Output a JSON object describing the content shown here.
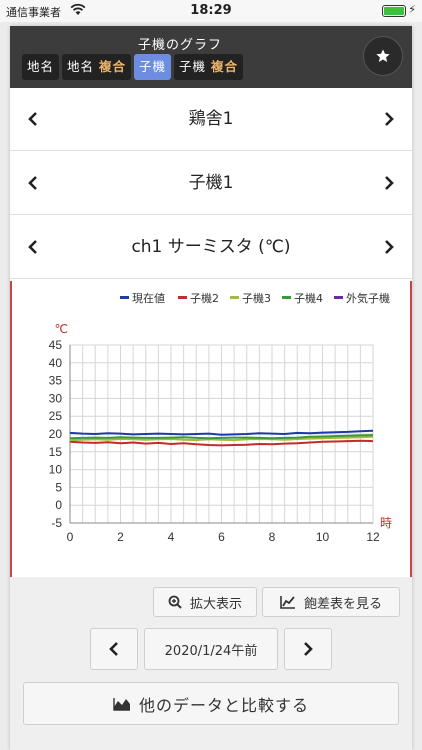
{
  "status_bar": {
    "carrier": "通信事業者",
    "time": "18:29"
  },
  "header": {
    "title": "子機のグラフ",
    "tabs": [
      {
        "text": "地名",
        "highlight": "",
        "active": false
      },
      {
        "text": "地名",
        "highlight": "複合",
        "active": false
      },
      {
        "text": "子機",
        "highlight": "",
        "active": true
      },
      {
        "text": "子機",
        "highlight": "複合",
        "active": false
      }
    ],
    "star_icon": "star-icon"
  },
  "selectors": [
    {
      "label": "鶏舎1"
    },
    {
      "label": "子機1"
    },
    {
      "label": "ch1 サーミスタ (℃)"
    }
  ],
  "chart_data": {
    "type": "line",
    "legend_position": "top-right",
    "grid": true,
    "ylabel": "℃",
    "xlabel": "時",
    "ylim": [
      -5,
      45
    ],
    "xlim": [
      0,
      12
    ],
    "y_ticks": [
      "45",
      "40",
      "35",
      "30",
      "25",
      "20",
      "15",
      "10",
      "5",
      "0",
      "-5"
    ],
    "x_ticks": [
      "0",
      "2",
      "4",
      "6",
      "8",
      "10",
      "12"
    ],
    "x": [
      0,
      0.5,
      1,
      1.5,
      2,
      2.5,
      3,
      3.5,
      4,
      4.5,
      5,
      5.5,
      6,
      6.5,
      7,
      7.5,
      8,
      8.5,
      9,
      9.5,
      10,
      10.5,
      11,
      11.5,
      12
    ],
    "series": [
      {
        "name": "現在値",
        "color": "#1e3aa8",
        "values": [
          20.3,
          20.1,
          20.0,
          20.2,
          20.1,
          19.9,
          20.0,
          20.1,
          20.0,
          19.9,
          20.0,
          20.1,
          19.8,
          19.9,
          20.0,
          20.2,
          20.1,
          20.0,
          20.3,
          20.2,
          20.4,
          20.5,
          20.6,
          20.8,
          20.9
        ]
      },
      {
        "name": "子機2",
        "color": "#c42b2b",
        "values": [
          17.8,
          17.6,
          17.5,
          17.7,
          17.4,
          17.6,
          17.3,
          17.5,
          17.2,
          17.4,
          17.1,
          16.9,
          16.8,
          16.9,
          17.0,
          17.2,
          17.1,
          17.3,
          17.4,
          17.6,
          17.8,
          17.9,
          18.0,
          18.1,
          18.0
        ]
      },
      {
        "name": "子機3",
        "color": "#a8b83a",
        "values": [
          18.3,
          18.4,
          18.5,
          18.4,
          18.6,
          18.5,
          18.4,
          18.5,
          18.6,
          18.4,
          18.3,
          18.5,
          18.4,
          18.3,
          18.5,
          18.6,
          18.5,
          18.4,
          18.6,
          18.7,
          18.8,
          18.9,
          19.0,
          19.1,
          19.2
        ]
      },
      {
        "name": "子機4",
        "color": "#3a9a3a",
        "values": [
          18.8,
          18.9,
          19.0,
          18.9,
          19.1,
          19.0,
          18.9,
          18.9,
          19.0,
          19.1,
          18.9,
          18.8,
          18.9,
          19.0,
          19.0,
          18.9,
          18.8,
          18.9,
          19.0,
          19.2,
          19.3,
          19.4,
          19.5,
          19.6,
          19.7
        ]
      },
      {
        "name": "外気子機",
        "color": "#6a2aa8",
        "values": []
      }
    ]
  },
  "buttons": {
    "zoom": "拡大表示",
    "saturation": "飽差表を見る",
    "date": "2020/1/24午前",
    "compare": "他のデータと比較する"
  }
}
